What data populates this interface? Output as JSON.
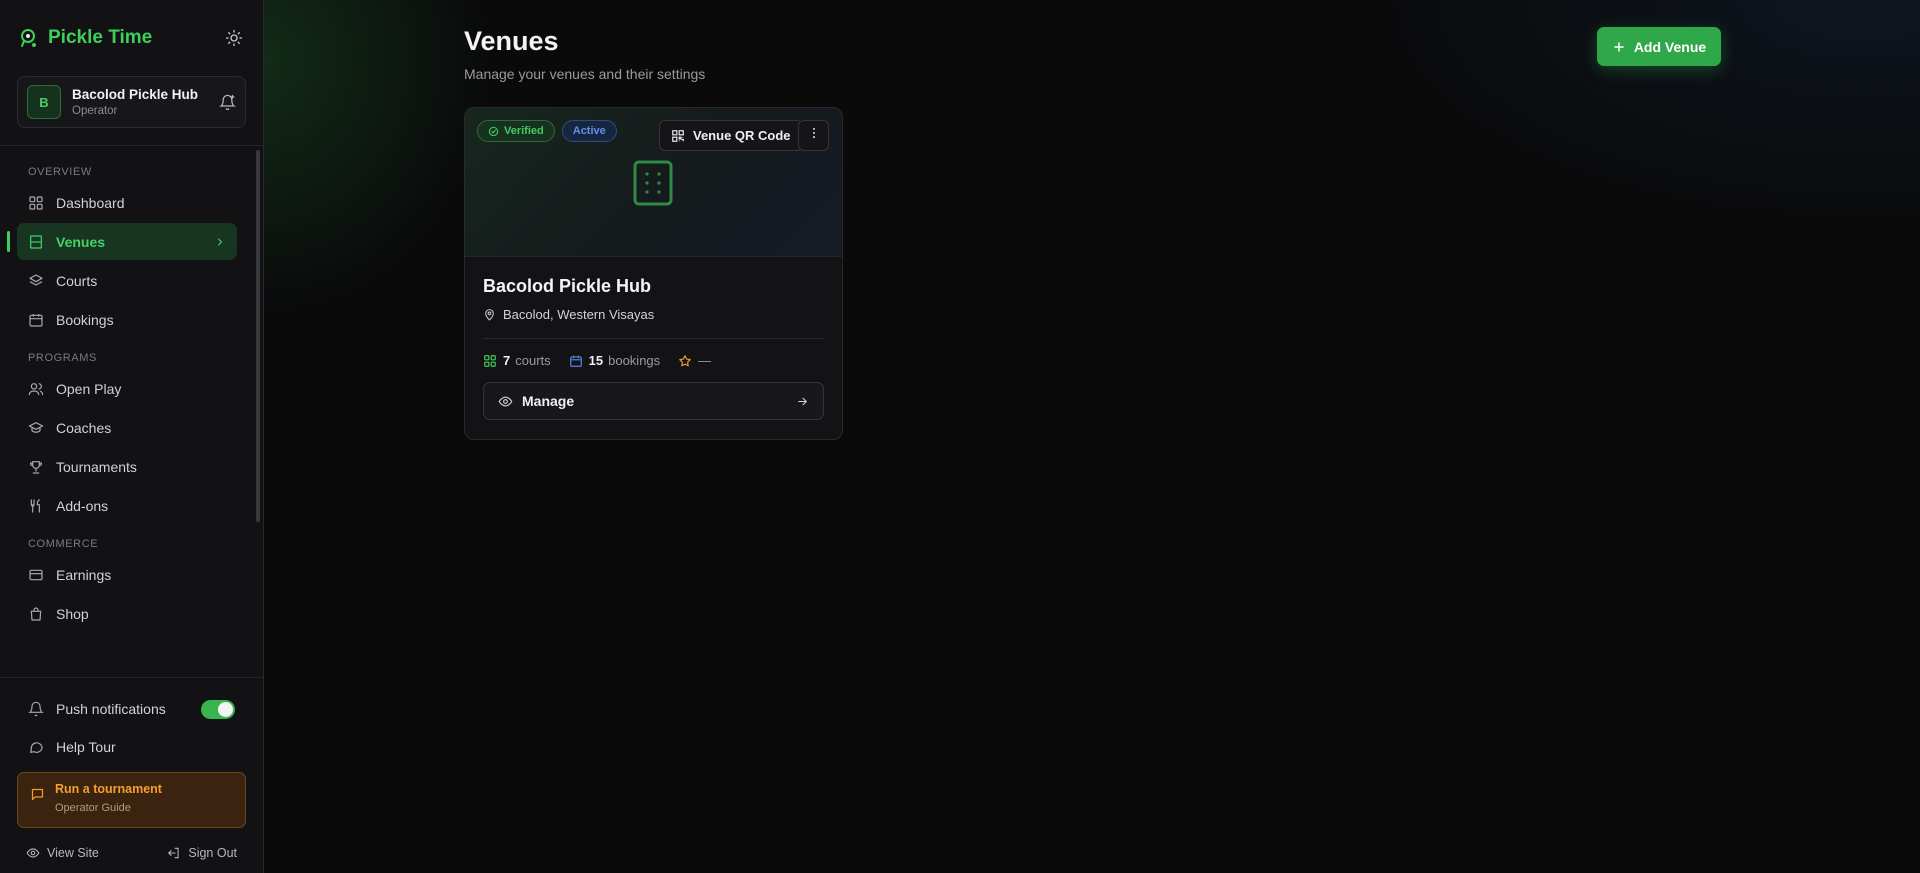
{
  "brand": {
    "name": "Pickle Time"
  },
  "org": {
    "avatar_letter": "B",
    "name": "Bacolod Pickle Hub",
    "role": "Operator"
  },
  "nav": {
    "overview_label": "OVERVIEW",
    "dashboard": "Dashboard",
    "venues": "Venues",
    "courts": "Courts",
    "bookings": "Bookings",
    "programs_label": "PROGRAMS",
    "open_play": "Open Play",
    "coaches": "Coaches",
    "tournaments": "Tournaments",
    "addons": "Add-ons",
    "commerce_label": "COMMERCE",
    "earnings": "Earnings",
    "shop": "Shop"
  },
  "bottom": {
    "push_notifications": "Push notifications",
    "push_enabled": true,
    "help_tour": "Help Tour",
    "promo_title": "Run a tournament",
    "promo_sub": "Operator Guide",
    "view_site": "View Site",
    "sign_out": "Sign Out"
  },
  "page": {
    "title": "Venues",
    "subtitle": "Manage your venues and their settings",
    "add_button": "Add Venue"
  },
  "venue": {
    "badge_verified": "Verified",
    "badge_active": "Active",
    "qr_button": "Venue QR Code",
    "name": "Bacolod Pickle Hub",
    "location": "Bacolod, Western Visayas",
    "courts_count": "7",
    "courts_label": "courts",
    "bookings_count": "15",
    "bookings_label": "bookings",
    "rating": "—",
    "manage_button": "Manage"
  },
  "colors": {
    "accent": "#3ecf5a",
    "primary_button": "#2fa84a",
    "active_badge": "#5e92e8",
    "promo": "#f59e2e"
  }
}
